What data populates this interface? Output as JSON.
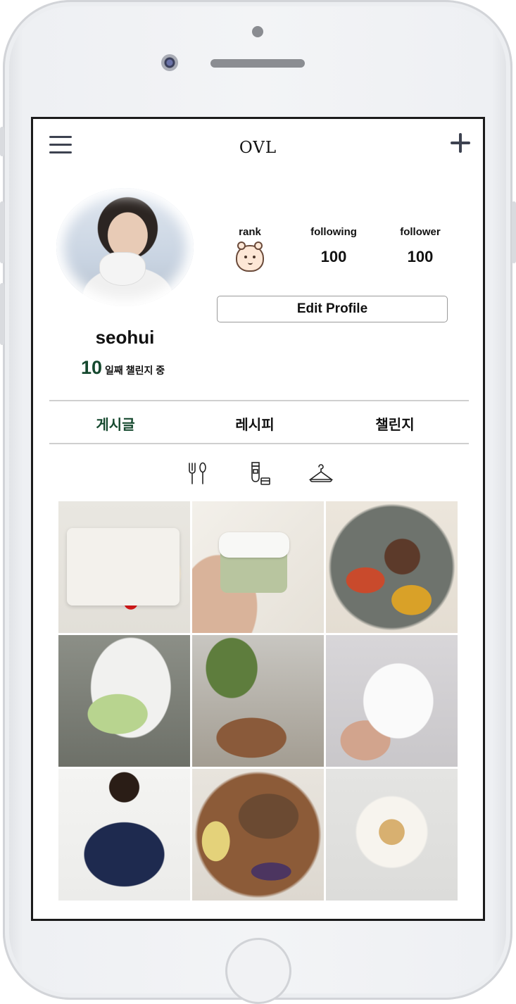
{
  "app": {
    "title": "OVL"
  },
  "profile": {
    "username": "seohui",
    "challenge_days": "10",
    "challenge_label": "일째 챌린지 중",
    "edit_button": "Edit Profile"
  },
  "stats": {
    "rank_label": "rank",
    "rank_icon": "bear-face-icon",
    "following_label": "following",
    "following_value": "100",
    "follower_label": "follower",
    "follower_value": "100"
  },
  "tabs": [
    {
      "label": "게시글",
      "active": true
    },
    {
      "label": "레시피",
      "active": false
    },
    {
      "label": "챌린지",
      "active": false
    }
  ],
  "categories": [
    "utensils-icon",
    "cosmetics-icon",
    "hanger-icon"
  ],
  "colors": {
    "accent": "#16492f",
    "icon": "#3d4250"
  }
}
